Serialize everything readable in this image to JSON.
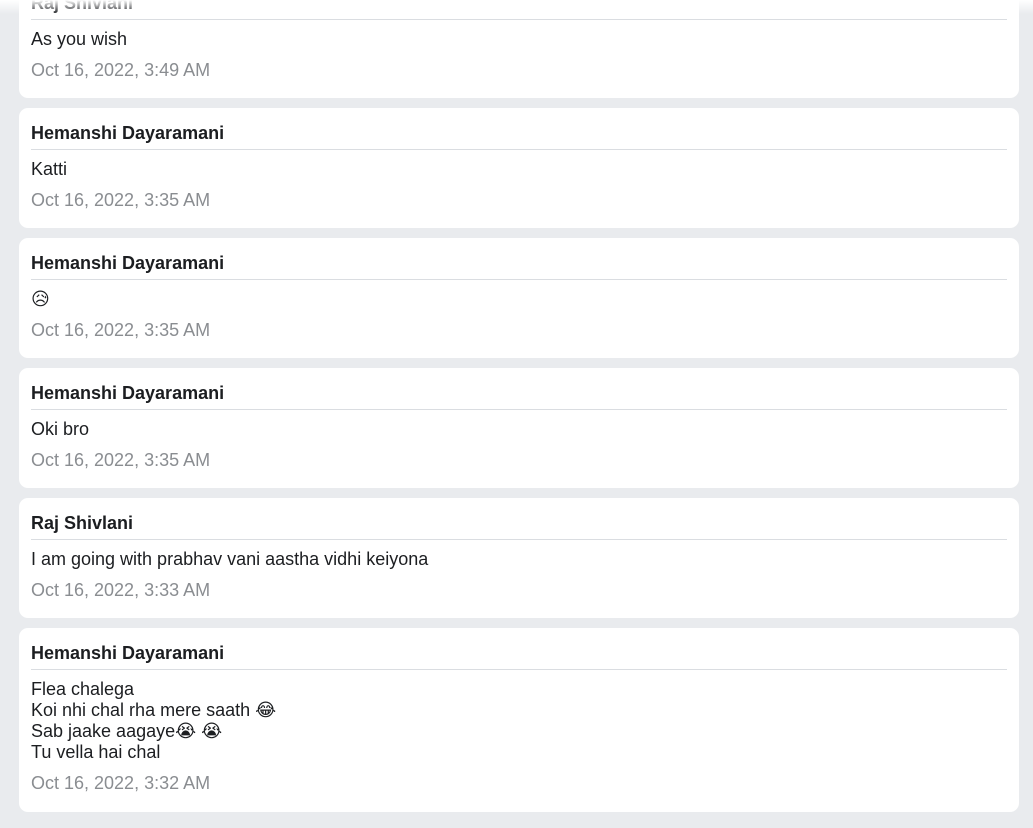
{
  "messages": [
    {
      "sender": "Raj Shivlani",
      "lines": [
        "As you wish"
      ],
      "timestamp": "Oct 16, 2022, 3:49 AM"
    },
    {
      "sender": "Hemanshi Dayaramani",
      "lines": [
        "Katti"
      ],
      "timestamp": "Oct 16, 2022, 3:35 AM"
    },
    {
      "sender": "Hemanshi Dayaramani",
      "lines": [
        "😥"
      ],
      "timestamp": "Oct 16, 2022, 3:35 AM"
    },
    {
      "sender": "Hemanshi Dayaramani",
      "lines": [
        "Oki bro"
      ],
      "timestamp": "Oct 16, 2022, 3:35 AM"
    },
    {
      "sender": "Raj Shivlani",
      "lines": [
        "I am going with prabhav vani aastha vidhi keiyona"
      ],
      "timestamp": "Oct 16, 2022, 3:33 AM"
    },
    {
      "sender": "Hemanshi Dayaramani",
      "lines": [
        "Flea chalega",
        "Koi nhi chal rha mere saath 😂",
        "Sab jaake aagaye😭 😭",
        "Tu vella hai chal"
      ],
      "timestamp": "Oct 16, 2022, 3:32 AM"
    }
  ]
}
